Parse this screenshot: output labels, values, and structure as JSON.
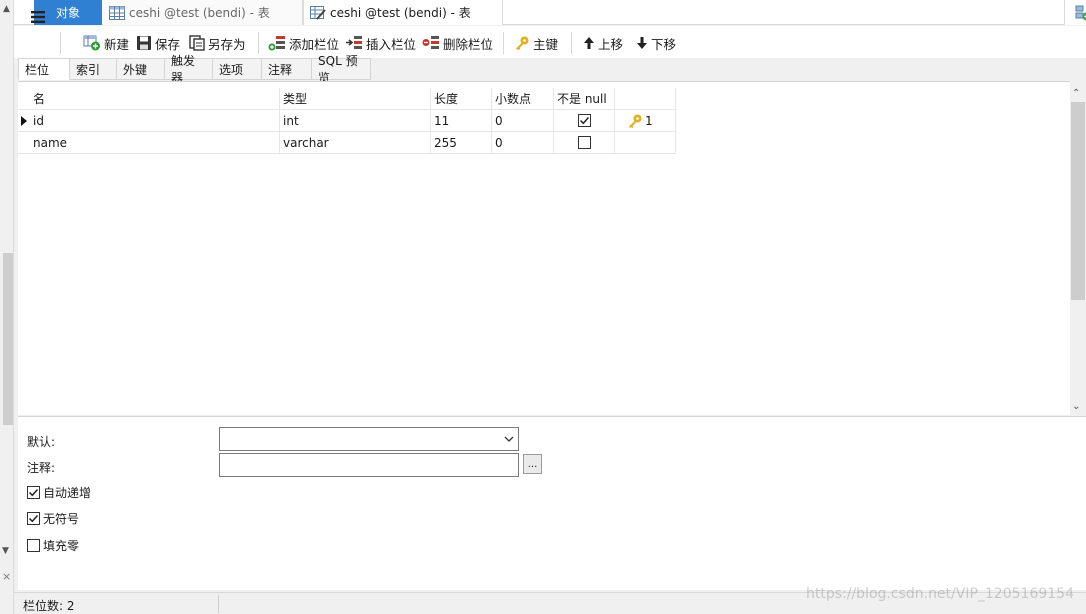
{
  "doc_tabs": {
    "objects": "对象",
    "tab1": "ceshi @test (bendi) - 表",
    "tab2": "ceshi @test (bendi) - 表"
  },
  "toolbar": {
    "new": "新建",
    "save": "保存",
    "save_as": "另存为",
    "add_field": "添加栏位",
    "insert_field": "插入栏位",
    "delete_field": "删除栏位",
    "primary_key": "主键",
    "move_up": "上移",
    "move_down": "下移"
  },
  "sub_tabs": [
    "栏位",
    "索引",
    "外键",
    "触发器",
    "选项",
    "注释",
    "SQL 预览"
  ],
  "grid": {
    "headers": [
      "名",
      "类型",
      "长度",
      "小数点",
      "不是 null",
      ""
    ],
    "rows": [
      {
        "name": "id",
        "type": "int",
        "length": "11",
        "decimals": "0",
        "not_null": true,
        "key": "1"
      },
      {
        "name": "name",
        "type": "varchar",
        "length": "255",
        "decimals": "0",
        "not_null": false,
        "key": ""
      }
    ]
  },
  "props": {
    "default_label": "默认:",
    "default_value": "",
    "comment_label": "注释:",
    "comment_value": "",
    "ellipsis": "...",
    "auto_increment": "自动递增",
    "unsigned": "无符号",
    "zerofill": "填充零",
    "auto_increment_checked": true,
    "unsigned_checked": true,
    "zerofill_checked": false
  },
  "status": {
    "field_count": "栏位数: 2"
  },
  "watermark": "https://blog.csdn.net/VIP_1205169154",
  "colors": {
    "accent": "#2f7fd3",
    "key_icon": "#e0b020"
  }
}
